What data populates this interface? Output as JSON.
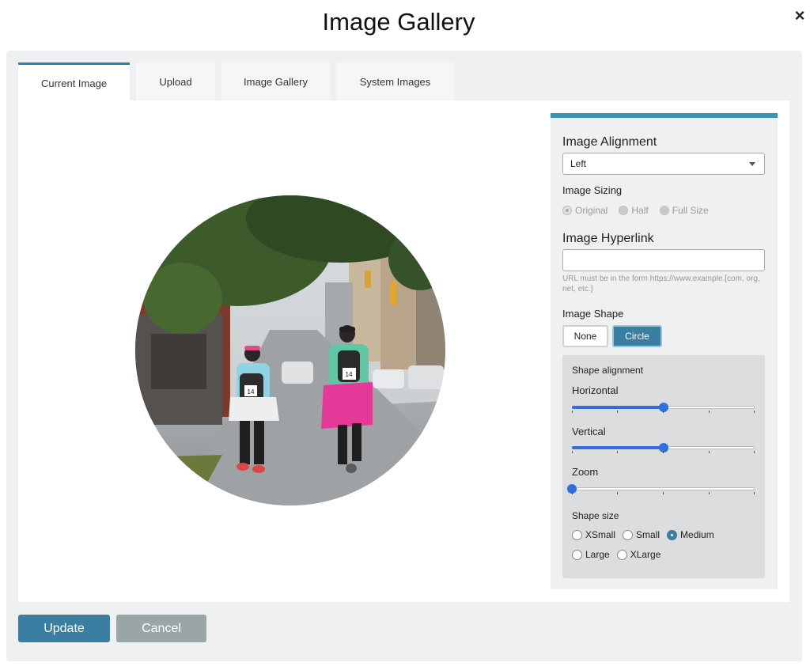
{
  "dialog": {
    "title": "Image Gallery",
    "close_label": "×"
  },
  "tabs": [
    {
      "label": "Current Image",
      "active": true
    },
    {
      "label": "Upload",
      "active": false
    },
    {
      "label": "Image Gallery",
      "active": false
    },
    {
      "label": "System Images",
      "active": false
    }
  ],
  "sidebar": {
    "alignment": {
      "label": "Image Alignment",
      "value": "Left"
    },
    "sizing": {
      "label": "Image Sizing",
      "options": [
        {
          "label": "Original",
          "selected": true
        },
        {
          "label": "Half",
          "selected": false
        },
        {
          "label": "Full Size",
          "selected": false
        }
      ]
    },
    "hyperlink": {
      "label": "Image Hyperlink",
      "value": "",
      "help": "URL must be in the form https://www.example.[com, org, net, etc.]"
    },
    "shape": {
      "label": "Image Shape",
      "options": [
        {
          "label": "None",
          "selected": false
        },
        {
          "label": "Circle",
          "selected": true
        }
      ],
      "alignment_title": "Shape alignment",
      "horizontal": {
        "label": "Horizontal",
        "value": 0.5
      },
      "vertical": {
        "label": "Vertical",
        "value": 0.5
      },
      "zoom": {
        "label": "Zoom",
        "value": 0.0
      },
      "size_label": "Shape size",
      "sizes_row1": [
        {
          "label": "XSmall",
          "selected": false
        },
        {
          "label": "Small",
          "selected": false
        },
        {
          "label": "Medium",
          "selected": true
        }
      ],
      "sizes_row2": [
        {
          "label": "Large",
          "selected": false
        },
        {
          "label": "XLarge",
          "selected": false
        }
      ]
    }
  },
  "footer": {
    "update_label": "Update",
    "cancel_label": "Cancel"
  },
  "colors": {
    "accent": "#3a7ea1",
    "slider": "#2f6fe0",
    "cancel": "#9aa5a6"
  },
  "preview": {
    "shape": "circle",
    "subject": "two runners with race bibs 14 on a city street"
  }
}
